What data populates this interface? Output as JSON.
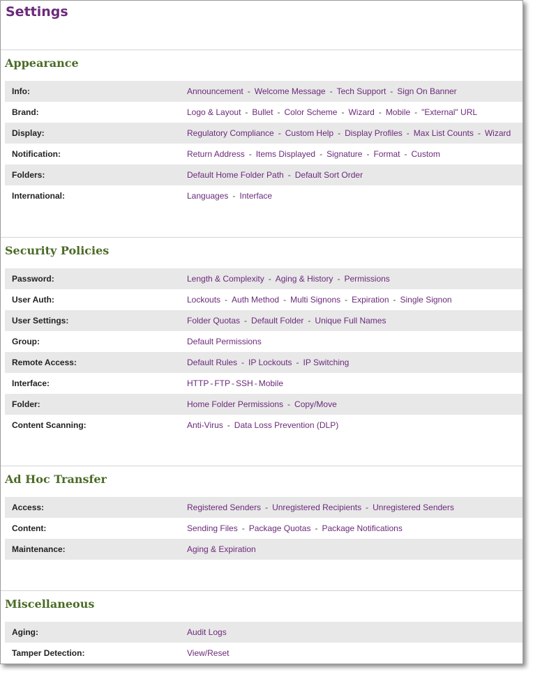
{
  "page": {
    "title": "Settings"
  },
  "colors": {
    "title": "#6b2a7a",
    "section_title": "#4b6b26",
    "link": "#6b2a7a",
    "row_shade": "#e8e8e8"
  },
  "sections": [
    {
      "title": "Appearance",
      "rows": [
        {
          "label": "Info:",
          "links": [
            "Announcement",
            "Welcome Message",
            "Tech Support",
            "Sign On Banner"
          ]
        },
        {
          "label": "Brand:",
          "links": [
            "Logo & Layout",
            "Bullet",
            "Color Scheme",
            "Wizard",
            "Mobile",
            "\"External\" URL"
          ]
        },
        {
          "label": "Display:",
          "links": [
            "Regulatory Compliance",
            "Custom Help",
            "Display Profiles",
            "Max List Counts",
            "Wizard"
          ]
        },
        {
          "label": "Notification:",
          "links": [
            "Return Address",
            "Items Displayed",
            "Signature",
            "Format",
            "Custom"
          ]
        },
        {
          "label": "Folders:",
          "links": [
            "Default Home Folder Path",
            "Default Sort Order"
          ]
        },
        {
          "label": "International:",
          "links": [
            "Languages",
            "Interface"
          ]
        }
      ]
    },
    {
      "title": "Security Policies",
      "rows": [
        {
          "label": "Password:",
          "links": [
            "Length & Complexity",
            "Aging & History",
            "Permissions"
          ]
        },
        {
          "label": "User Auth:",
          "links": [
            "Lockouts",
            "Auth Method",
            "Multi Signons",
            "Expiration",
            "Single Signon"
          ]
        },
        {
          "label": "User Settings:",
          "links": [
            "Folder Quotas",
            "Default Folder",
            "Unique Full Names"
          ]
        },
        {
          "label": "Group:",
          "links": [
            "Default Permissions"
          ]
        },
        {
          "label": "Remote Access:",
          "links": [
            "Default Rules",
            "IP Lockouts",
            "IP Switching"
          ]
        },
        {
          "label": "Interface:",
          "links": [
            "HTTP",
            "FTP",
            "SSH",
            "Mobile"
          ],
          "tight": true
        },
        {
          "label": "Folder:",
          "links": [
            "Home Folder Permissions",
            "Copy/Move"
          ]
        },
        {
          "label": "Content Scanning:",
          "links": [
            "Anti-Virus",
            "Data Loss Prevention (DLP)"
          ]
        }
      ]
    },
    {
      "title": "Ad Hoc Transfer",
      "rows": [
        {
          "label": "Access:",
          "links": [
            "Registered Senders",
            "Unregistered Recipients",
            "Unregistered Senders"
          ]
        },
        {
          "label": "Content:",
          "links": [
            "Sending Files",
            "Package Quotas",
            "Package Notifications"
          ]
        },
        {
          "label": "Maintenance:",
          "links": [
            "Aging & Expiration"
          ]
        }
      ]
    },
    {
      "title": "Miscellaneous",
      "rows": [
        {
          "label": "Aging:",
          "links": [
            "Audit Logs"
          ]
        },
        {
          "label": "Tamper Detection:",
          "links": [
            "View/Reset"
          ]
        }
      ]
    }
  ]
}
